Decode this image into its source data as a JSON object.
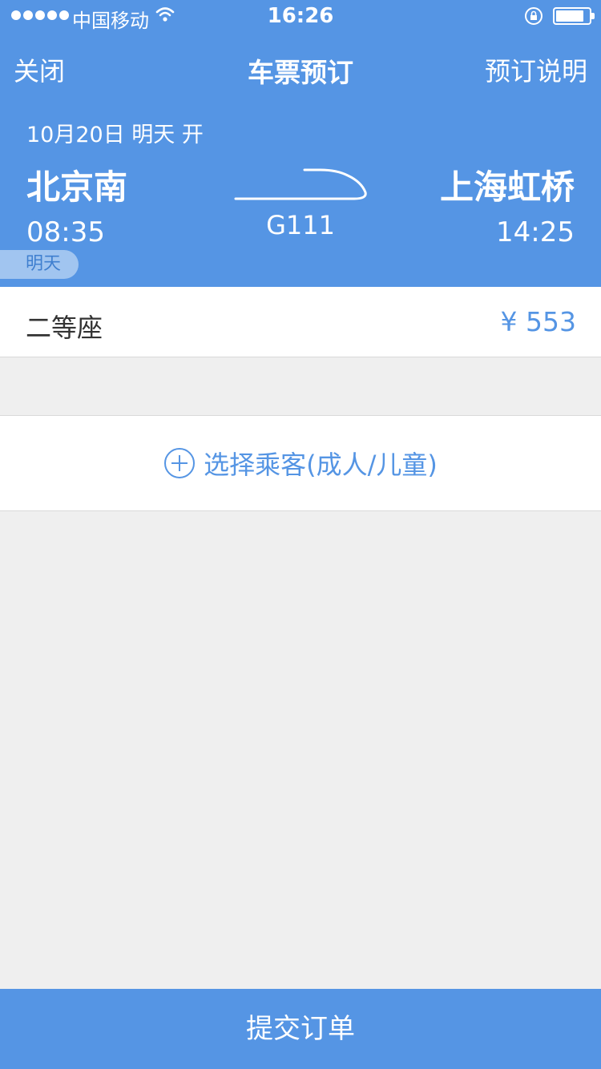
{
  "status_bar": {
    "carrier": "中国移动",
    "time": "16:26",
    "signal_bars": 5,
    "battery_level": 0.85
  },
  "nav": {
    "close_label": "关闭",
    "title": "车票预订",
    "info_label": "预订说明"
  },
  "trip": {
    "date": "10月20日 明天 开",
    "from_station": "北京南",
    "to_station": "上海虹桥",
    "train_number": "G111",
    "depart_time": "08:35",
    "arrive_time": "14:25",
    "day_badge": "明天"
  },
  "seat": {
    "type": "二等座",
    "price": "¥ 553"
  },
  "passenger": {
    "select_label": "选择乘客(成人/儿童)"
  },
  "submit": {
    "label": "提交订单"
  },
  "colors": {
    "primary": "#5595e4",
    "background": "#efefef",
    "text_dark": "#333333"
  }
}
